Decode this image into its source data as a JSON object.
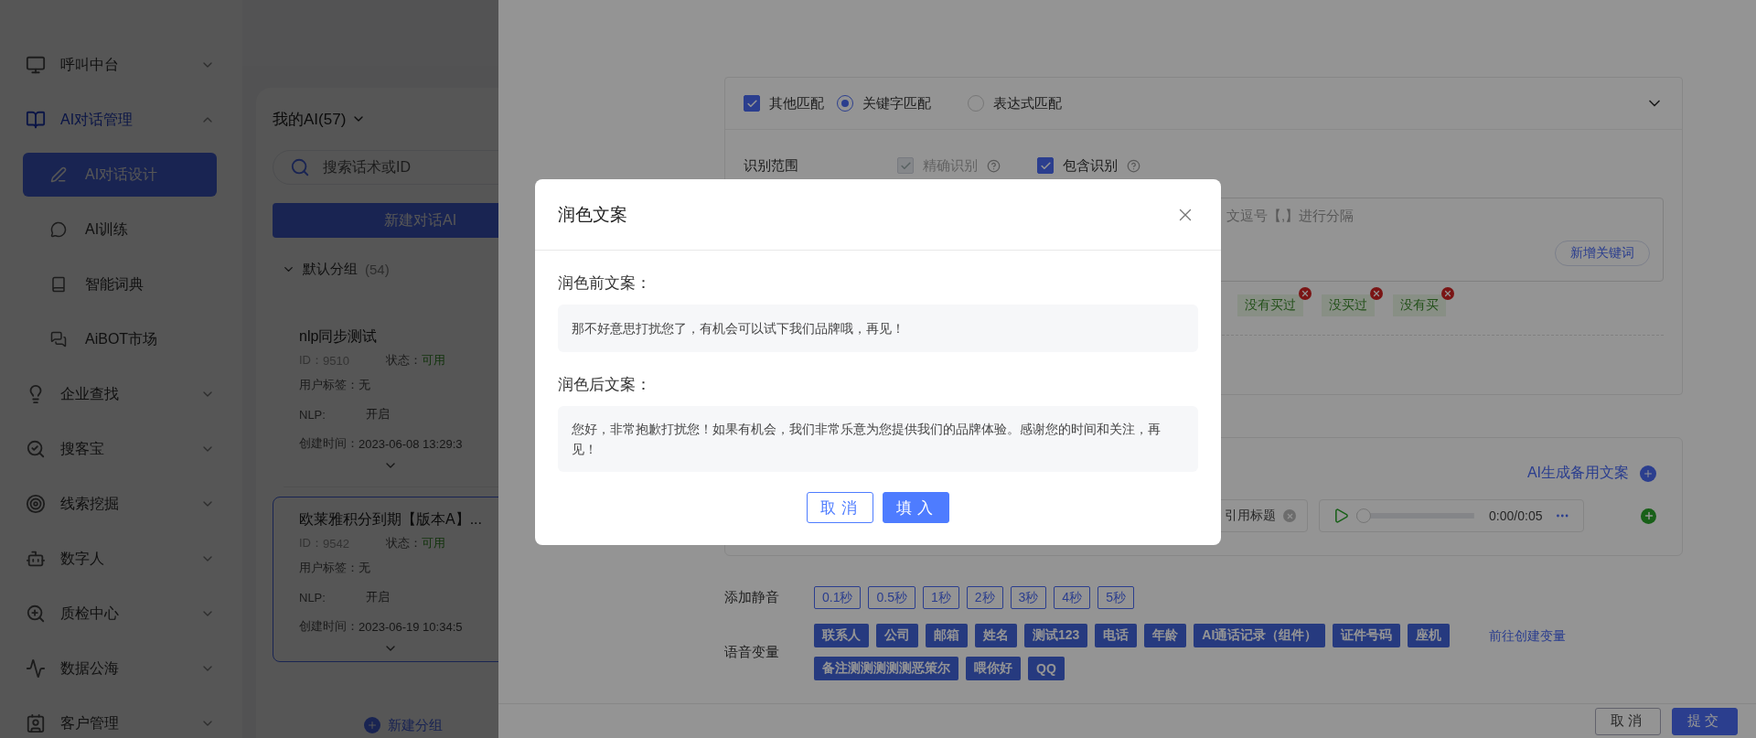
{
  "sidebar": {
    "items": [
      {
        "label": "呼叫中台",
        "expanded": false
      },
      {
        "label": "AI对话管理",
        "expanded": true,
        "children": [
          {
            "label": "AI对话设计",
            "selected": true
          },
          {
            "label": "AI训练",
            "selected": false
          },
          {
            "label": "智能词典",
            "selected": false
          },
          {
            "label": "AiBOT市场",
            "selected": false
          }
        ]
      },
      {
        "label": "企业查找",
        "expanded": false
      },
      {
        "label": "搜客宝",
        "expanded": false
      },
      {
        "label": "线索挖掘",
        "expanded": false
      },
      {
        "label": "数字人",
        "expanded": false
      },
      {
        "label": "质检中心",
        "expanded": false
      },
      {
        "label": "数据公海",
        "expanded": false
      },
      {
        "label": "客户管理",
        "expanded": false
      }
    ]
  },
  "ai_list": {
    "title": "我的AI(57)",
    "search": {
      "placeholder": "搜索话术或ID"
    },
    "new_button": "新建对话AI",
    "group": {
      "name": "默认分组",
      "count": "(54)",
      "expanded": true
    },
    "items": [
      {
        "name": "nlp同步测试",
        "id_label": "ID：",
        "id": "9510",
        "status_label": "状态：",
        "status": "可用",
        "tags_label": "用户标签：",
        "tags": "无",
        "nlp_label": "NLP:",
        "nlp": "开启",
        "created_label": "创建时间：",
        "created": "2023-06-08 13:29:3",
        "selected": false
      },
      {
        "name": "欧莱雅积分到期【版本A】...",
        "id_label": "ID：",
        "id": "9542",
        "status_label": "状态：",
        "status": "可用",
        "tags_label": "用户标签：",
        "tags": "无",
        "nlp_label": "NLP:",
        "nlp": "开启",
        "created_label": "创建时间：",
        "created": "2023-06-19 10:34:5",
        "selected": true
      }
    ],
    "add_group": "新建分组"
  },
  "drawer": {
    "match_card": {
      "other_match": {
        "label": "其他匹配",
        "checked": true
      },
      "modes": [
        {
          "label": "关键字匹配",
          "selected": true
        },
        {
          "label": "表达式匹配",
          "selected": false
        }
      ],
      "expanded": true,
      "scope": {
        "label": "识别范围",
        "options": [
          {
            "label": "精确识别",
            "checked": true,
            "disabled": true
          },
          {
            "label": "包含识别",
            "checked": true,
            "disabled": false
          }
        ]
      },
      "keyword_input": {
        "placeholder": "文逗号【,】进行分隔"
      },
      "add_keyword": "新增关键词",
      "keywords": [
        "没有买过",
        "没买过",
        "没有买"
      ]
    },
    "reply_card": {
      "ai_generate": "AI生成备用文案",
      "quote_chip": "引用标题",
      "audio": {
        "time": "0:00/0:05",
        "level": 0
      }
    },
    "silence": {
      "label": "添加静音",
      "options": [
        "0.1秒",
        "0.5秒",
        "1秒",
        "2秒",
        "3秒",
        "4秒",
        "5秒"
      ]
    },
    "variables": {
      "label": "语音变量",
      "tags": [
        "联系人",
        "公司",
        "邮箱",
        "姓名",
        "测试123",
        "电话",
        "年龄",
        "AI通话记录（组件）",
        "证件号码",
        "座机",
        "备注测测测测测恶策尔",
        "喂你好",
        "QQ"
      ],
      "create_link": "前往创建变量"
    },
    "footer": {
      "cancel": "取消",
      "submit": "提交"
    }
  },
  "dialog": {
    "title": "润色文案",
    "before_label": "润色前文案：",
    "before_text": "那不好意思打扰您了，有机会可以试下我们品牌哦，再见！",
    "after_label": "润色后文案：",
    "after_text": "您好，非常抱歉打扰您！如果有机会，我们非常乐意为您提供我们的品牌体验。感谢您的时间和关注，再见！",
    "cancel": "取消",
    "confirm": "填入"
  }
}
